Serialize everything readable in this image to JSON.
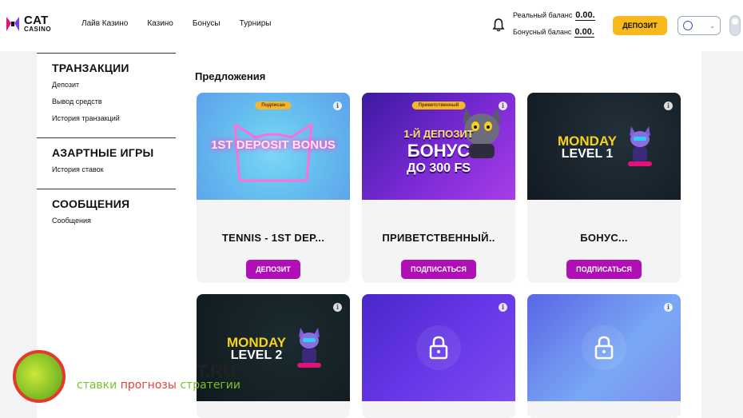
{
  "header": {
    "logo_line1": "CAT",
    "logo_line2": "CASINO",
    "nav": [
      "Лайв Казино",
      "Казино",
      "Бонусы",
      "Турниры"
    ],
    "real_balance_label": "Реальный баланс",
    "real_balance_value": "0.00.",
    "bonus_balance_label": "Бонусный баланс",
    "bonus_balance_value": "0.00.",
    "deposit_button": "ДЕПОЗИТ"
  },
  "sidebar": {
    "sections": [
      {
        "title": "ТРАНЗАКЦИИ",
        "items": [
          "Депозит",
          "Вывод средств",
          "История транзакций"
        ]
      },
      {
        "title": "АЗАРТНЫЕ ИГРЫ",
        "items": [
          "История ставок"
        ]
      },
      {
        "title": "СООБЩЕНИЯ",
        "items": [
          "Сообщения"
        ]
      }
    ]
  },
  "main": {
    "offers_title": "Предложения",
    "cards": [
      {
        "badge": "Подписан",
        "image_text": "1ST DEPOSIT BONUS",
        "title": "TENNIS - 1ST DEP...",
        "cta": "ДЕПОЗИТ"
      },
      {
        "badge": "Приветственный",
        "image_text_line1": "1-Й ДЕПОЗИТ",
        "image_text_line2": "БОНУС",
        "image_text_line3": "ДО 300 FS",
        "title": "ПРИВЕТСТВЕННЫЙ..",
        "cta": "ПОДПИСАТЬСЯ"
      },
      {
        "image_text_line1": "MONDAY",
        "image_text_line2": "LEVEL 1",
        "title": "БОНУС...",
        "cta": "ПОДПИСАТЬСЯ"
      },
      {
        "image_text_line1": "MONDAY",
        "image_text_line2": "LEVEL 2"
      },
      {
        "locked": true
      },
      {
        "locked": true
      }
    ]
  },
  "watermark": {
    "domain_text": "T.RU",
    "tag1": "ставки",
    "tag2": "прогнозы",
    "tag3": "стратегии"
  },
  "colors": {
    "accent_yellow": "#f8b91d",
    "cta_magenta": "#b10fb6",
    "badge_orange": "#f7b62a"
  }
}
